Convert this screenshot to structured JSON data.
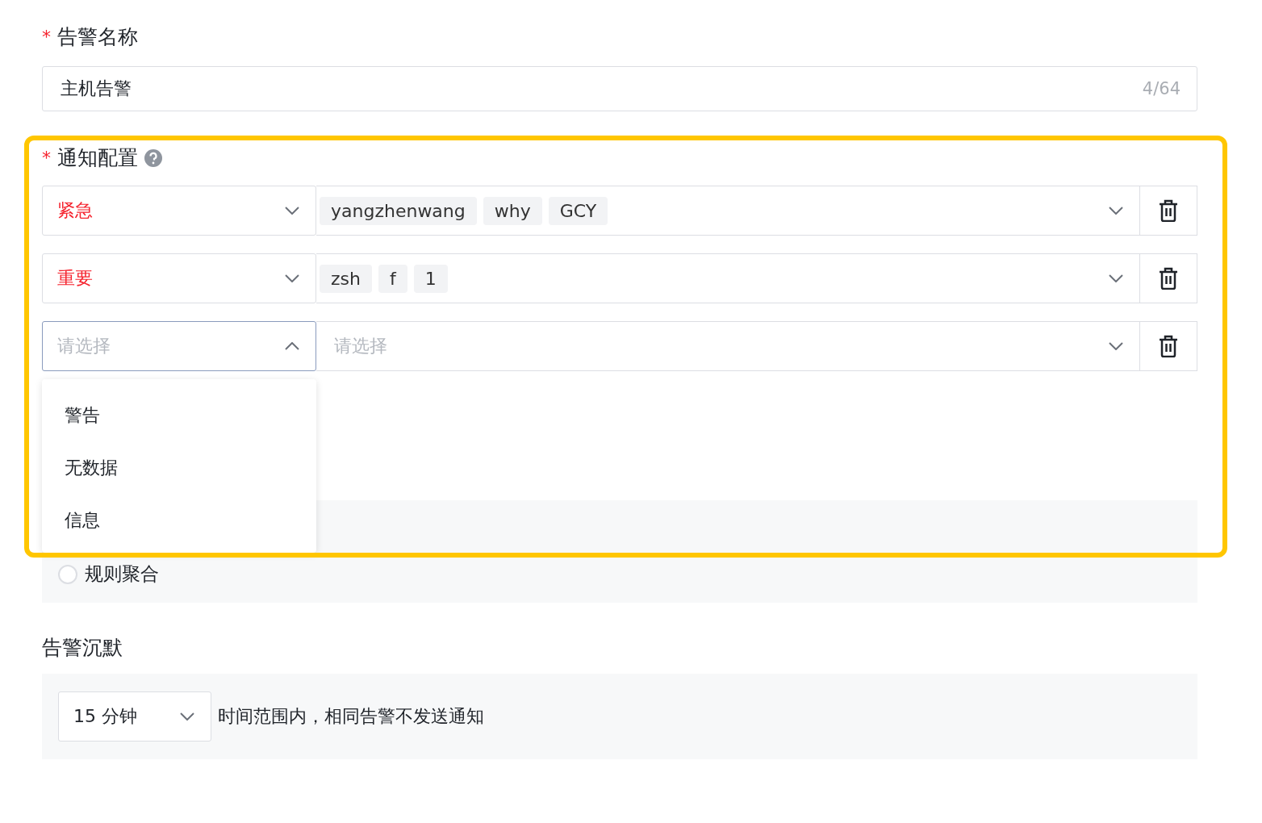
{
  "alert_name": {
    "required_mark": "*",
    "label": "告警名称",
    "value": "主机告警",
    "counter": "4/64"
  },
  "notification": {
    "required_mark": "*",
    "label": "通知配置",
    "rows": [
      {
        "level": "紧急",
        "open": false,
        "recipients": [
          "yangzhenwang",
          "why",
          "GCY"
        ]
      },
      {
        "level": "重要",
        "open": false,
        "recipients": [
          "zsh",
          "f",
          "1"
        ]
      },
      {
        "level_placeholder": "请选择",
        "open": true,
        "recipients_placeholder": "请选择"
      }
    ],
    "dropdown": [
      {
        "label": "警告"
      },
      {
        "label": "无数据"
      },
      {
        "label": "信息"
      }
    ],
    "aggregation": {
      "label": "规则聚合",
      "selected": false
    }
  },
  "silence": {
    "label": "告警沉默",
    "duration": "15 分钟",
    "text": "时间范围内，相同告警不发送通知"
  }
}
